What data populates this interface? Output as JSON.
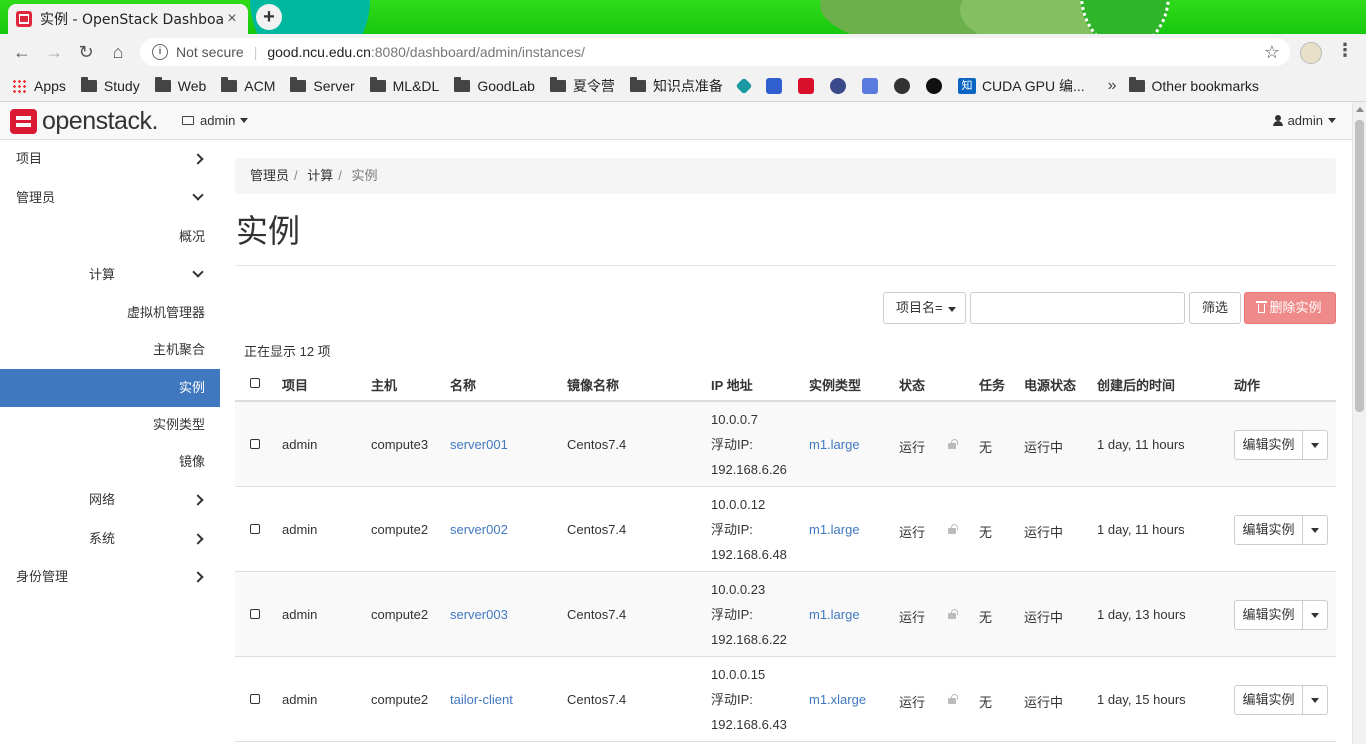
{
  "browser": {
    "tab_title": "实例 - OpenStack Dashboard",
    "new_tab": "+",
    "close": "×",
    "security": "Not secure",
    "url_host": "good.ncu.edu.cn",
    "url_path": ":8080/dashboard/admin/instances/",
    "bookmarks": [
      "Apps",
      "Study",
      "Web",
      "ACM",
      "Server",
      "ML&DL",
      "GoodLab",
      "夏令营",
      "知识点准备"
    ],
    "bookmark_zhi": "知",
    "bookmark_cuda": "CUDA GPU 编...",
    "more": "»",
    "other_bookmarks": "Other bookmarks"
  },
  "header": {
    "logo": "openstack.",
    "project": "admin",
    "user": "admin"
  },
  "sidebar": {
    "project": "项目",
    "admin": "管理员",
    "overview": "概况",
    "compute": "计算",
    "hypervisors": "虚拟机管理器",
    "host_aggregates": "主机聚合",
    "instances": "实例",
    "flavors": "实例类型",
    "images": "镜像",
    "network": "网络",
    "system": "系统",
    "identity": "身份管理"
  },
  "breadcrumb": [
    "管理员",
    "计算",
    "实例"
  ],
  "page_title": "实例",
  "filter": {
    "field": "项目名=",
    "button": "筛选",
    "delete": "删除实例"
  },
  "count_text": "正在显示 12 项",
  "table": {
    "headers": {
      "project": "项目",
      "host": "主机",
      "name": "名称",
      "image": "镜像名称",
      "ip": "IP 地址",
      "flavor": "实例类型",
      "status": "状态",
      "task": "任务",
      "power": "电源状态",
      "age": "创建后的时间",
      "actions": "动作"
    },
    "rows": [
      {
        "project": "admin",
        "host": "compute3",
        "name": "server001",
        "image": "Centos7.4",
        "ip_fixed": "10.0.0.7",
        "ip_label": "浮动IP:",
        "ip_float": "192.168.6.26",
        "flavor": "m1.large",
        "status": "运行",
        "task": "无",
        "power": "运行中",
        "age": "1 day, 11 hours",
        "action": "编辑实例"
      },
      {
        "project": "admin",
        "host": "compute2",
        "name": "server002",
        "image": "Centos7.4",
        "ip_fixed": "10.0.0.12",
        "ip_label": "浮动IP:",
        "ip_float": "192.168.6.48",
        "flavor": "m1.large",
        "status": "运行",
        "task": "无",
        "power": "运行中",
        "age": "1 day, 11 hours",
        "action": "编辑实例"
      },
      {
        "project": "admin",
        "host": "compute2",
        "name": "server003",
        "image": "Centos7.4",
        "ip_fixed": "10.0.0.23",
        "ip_label": "浮动IP:",
        "ip_float": "192.168.6.22",
        "flavor": "m1.large",
        "status": "运行",
        "task": "无",
        "power": "运行中",
        "age": "1 day, 13 hours",
        "action": "编辑实例"
      },
      {
        "project": "admin",
        "host": "compute2",
        "name": "tailor-client",
        "image": "Centos7.4",
        "ip_fixed": "10.0.0.15",
        "ip_label": "浮动IP:",
        "ip_float": "192.168.6.43",
        "flavor": "m1.xlarge",
        "status": "运行",
        "task": "无",
        "power": "运行中",
        "age": "1 day, 15 hours",
        "action": "编辑实例"
      }
    ]
  }
}
